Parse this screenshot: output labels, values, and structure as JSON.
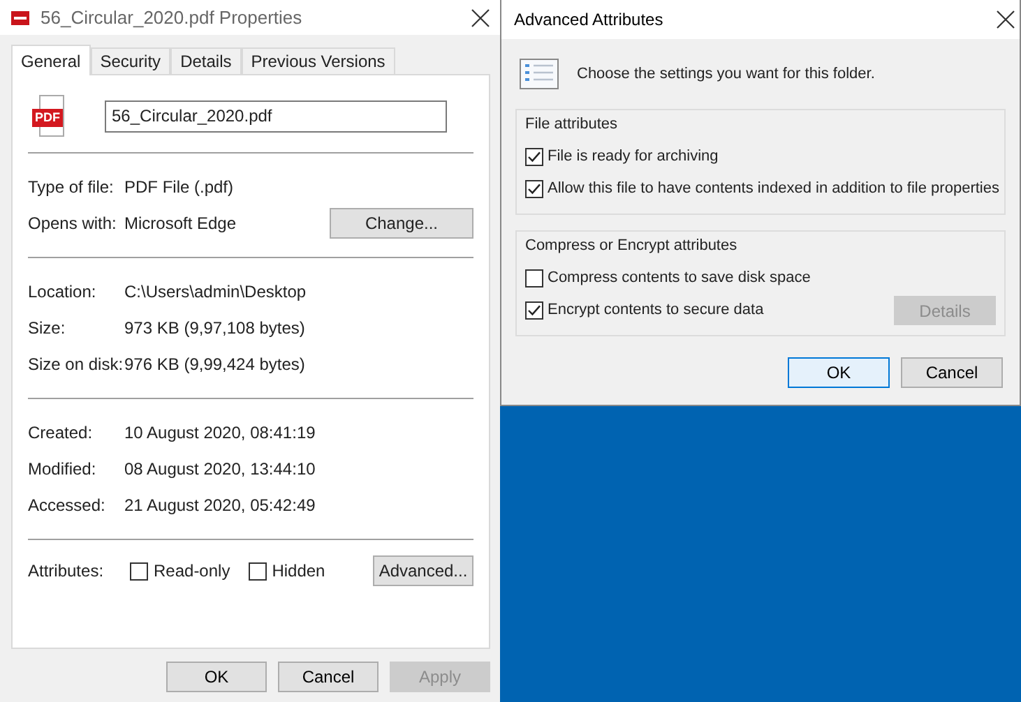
{
  "properties_window": {
    "title": "56_Circular_2020.pdf Properties",
    "tabs": [
      {
        "label": "General",
        "selected": true
      },
      {
        "label": "Security",
        "selected": false
      },
      {
        "label": "Details",
        "selected": false
      },
      {
        "label": "Previous Versions",
        "selected": false
      }
    ],
    "file_name": {
      "value": "56_Circular_2020.pdf"
    },
    "file_icon_label": "PDF",
    "sections": [
      [
        {
          "label": "Type of file:",
          "value": "PDF File (.pdf)"
        },
        {
          "label": "Opens with:",
          "value": "Microsoft Edge",
          "button": "Change..."
        }
      ],
      [
        {
          "label": "Location:",
          "value": "C:\\Users\\admin\\Desktop"
        },
        {
          "label": "Size:",
          "value": "973 KB (9,97,108 bytes)"
        },
        {
          "label": "Size on disk:",
          "value": "976 KB (9,99,424 bytes)"
        }
      ],
      [
        {
          "label": "Created:",
          "value": "10 August 2020, 08:41:19"
        },
        {
          "label": "Modified:",
          "value": "08 August 2020, 13:44:10"
        },
        {
          "label": "Accessed:",
          "value": "21 August 2020, 05:42:49"
        }
      ]
    ],
    "attributes": {
      "label": "Attributes:",
      "options": [
        {
          "label": "Read-only",
          "checked": false
        },
        {
          "label": "Hidden",
          "checked": false
        }
      ],
      "button": "Advanced..."
    },
    "buttons": [
      {
        "label": "OK",
        "disabled": false
      },
      {
        "label": "Cancel",
        "disabled": false
      },
      {
        "label": "Apply",
        "disabled": true
      }
    ]
  },
  "advanced_dialog": {
    "title": "Advanced Attributes",
    "description": "Choose the settings you want for this folder.",
    "groups": [
      {
        "title": "File attributes",
        "options": [
          {
            "label": "File is ready for archiving",
            "checked": true
          },
          {
            "label": "Allow this file to have contents indexed in addition to file properties",
            "checked": true
          }
        ]
      },
      {
        "title": "Compress or Encrypt attributes",
        "options": [
          {
            "label": "Compress contents to save disk space",
            "checked": false
          },
          {
            "label": "Encrypt contents to secure data",
            "checked": true,
            "button": {
              "label": "Details",
              "disabled": true
            }
          }
        ]
      }
    ],
    "buttons": [
      {
        "label": "OK",
        "disabled": false,
        "default": true
      },
      {
        "label": "Cancel",
        "disabled": false,
        "default": false
      }
    ]
  }
}
